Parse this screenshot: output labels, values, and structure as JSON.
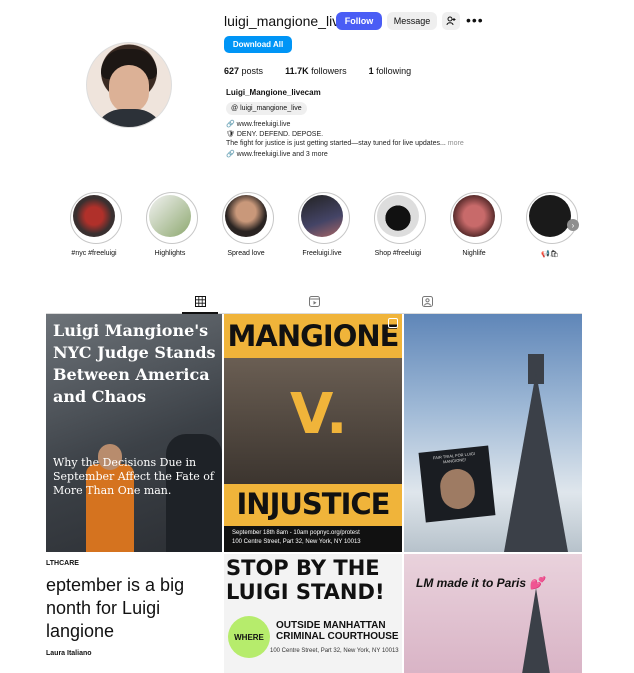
{
  "profile": {
    "username": "luigi_mangione_live",
    "follow_label": "Follow",
    "message_label": "Message",
    "download_label": "Download All",
    "posts_count": "627",
    "posts_label": "posts",
    "followers_count": "11.7K",
    "followers_label": "followers",
    "following_count": "1",
    "following_label": "following",
    "full_name": "Luigi_Mangione_livecam",
    "threads_handle": "luigi_mangione_live",
    "bio_link": "www.freeluigi.live",
    "bio_line1": "DENY. DEFEND. DEPOSE.",
    "bio_line2": "The fight for justice is just getting started—stay tuned for live updates...",
    "bio_more": "more",
    "bio_links": "www.freeluigi.live and 3 more"
  },
  "highlights": [
    {
      "label": "#nyc #freeluigi"
    },
    {
      "label": "Highlights"
    },
    {
      "label": "Spread love"
    },
    {
      "label": "Freeluigi.live"
    },
    {
      "label": "Shop #freeluigi"
    },
    {
      "label": "Nighlife"
    },
    {
      "label": "📢🛍"
    }
  ],
  "icons": {
    "add_user": "add-user-icon",
    "more": "more-dots-icon",
    "threads": "threads-icon",
    "link": "link-icon",
    "grid": "grid-icon",
    "reels": "reels-icon",
    "tagged": "tagged-icon",
    "next": "chevron-right-icon"
  },
  "posts": {
    "p1_title": "Luigi Mangione's NYC Judge Stands Between America and Chaos",
    "p1_sub": "Why the Decisions Due in September Affect the Fate of More Than One man.",
    "p2_top": "MANGIONE",
    "p2_v": "V.",
    "p2_bottom": "INJUSTICE",
    "p2_foot": "September 18th 8am - 10am     popnyc.org/protest",
    "p2_foot2": "100 Centre Street, Part 32, New York, NY 10013",
    "p3_card": "FAIR TRIAL FOR LUIGI MANGIONE!",
    "p4_tag": "LTHCARE",
    "p4_title": "eptember is a big nonth for Luigi langione",
    "p4_author": "Laura Italiano",
    "p5_title": "STOP BY THE LUIGI STAND!",
    "p5_badge": "WHERE",
    "p5_court": "OUTSIDE MANHATTAN CRIMINAL COURTHOUSE",
    "p5_addr": "100 Centre Street, Part 32, New York, NY 10013",
    "p6_text": "LM made it to Paris 💕"
  },
  "colors": {
    "follow": "#4a5df5",
    "download": "#0095f6",
    "poster_yellow": "#f0b43a",
    "badge_green": "#b6ec6c"
  }
}
